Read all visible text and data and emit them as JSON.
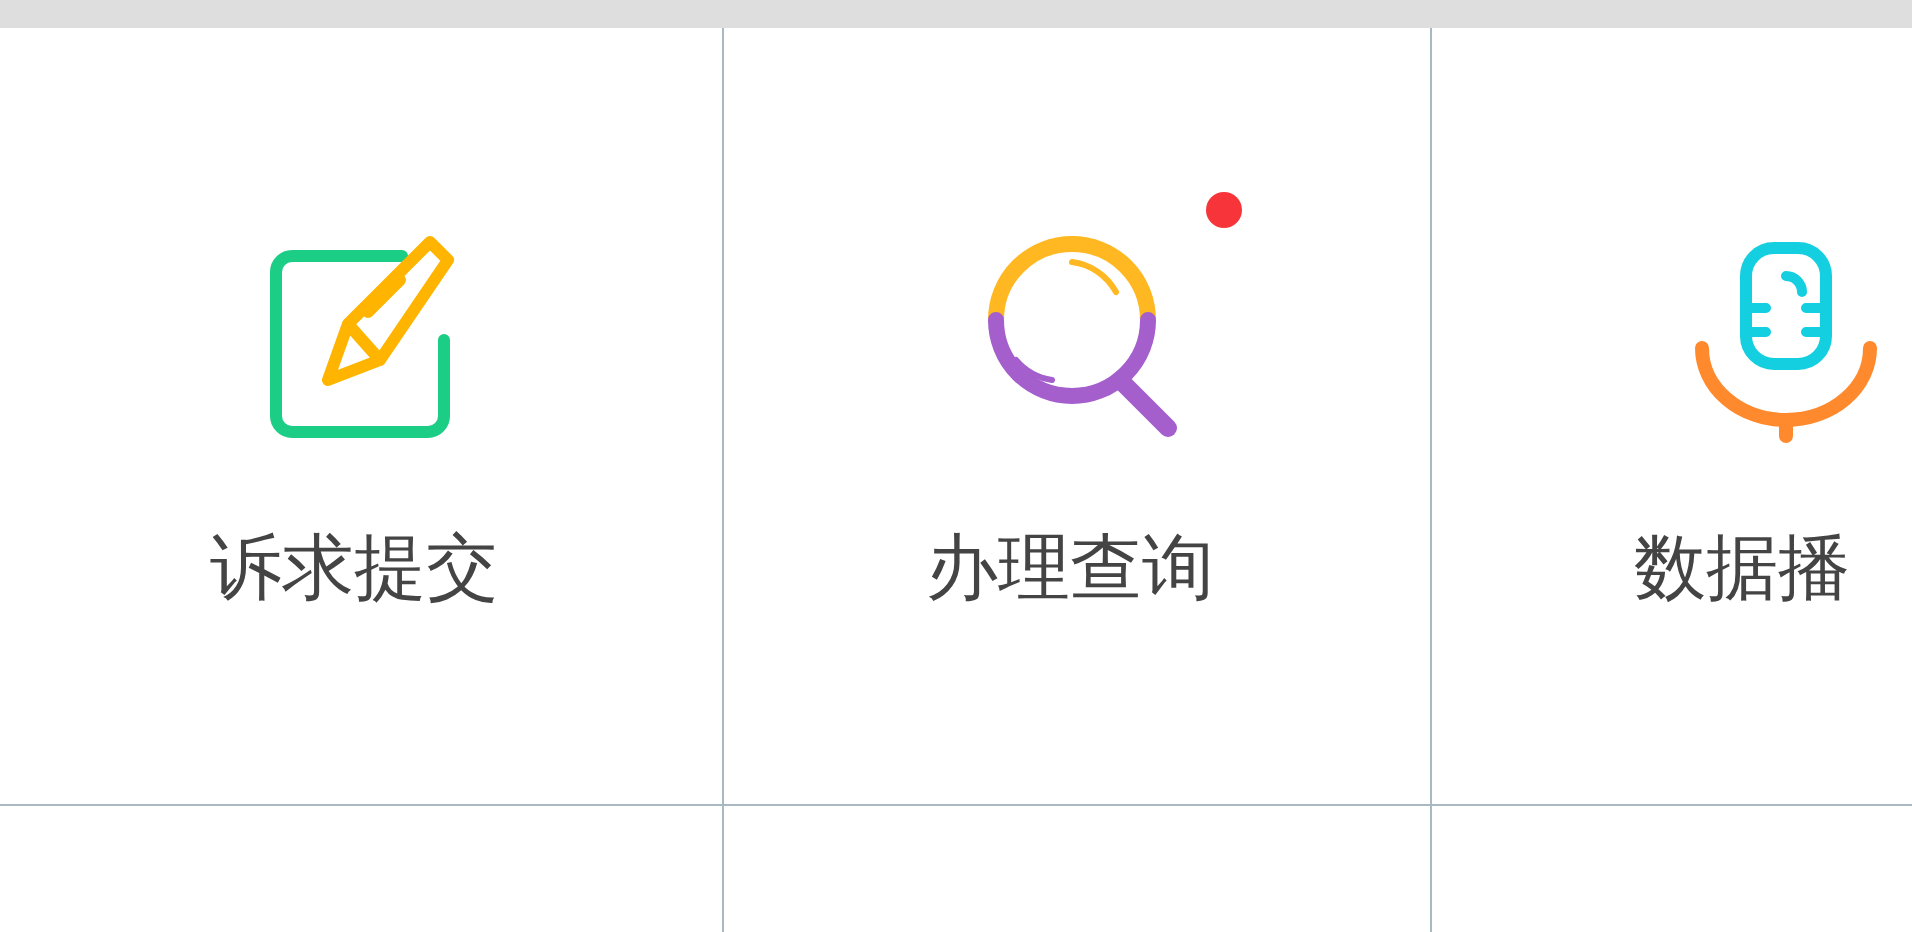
{
  "tiles": [
    {
      "label": "诉求提交",
      "kind": "pencil",
      "badge": false
    },
    {
      "label": "办理查询",
      "kind": "search",
      "badge": true
    },
    {
      "label": "数据播",
      "kind": "microphone",
      "badge": false
    }
  ]
}
